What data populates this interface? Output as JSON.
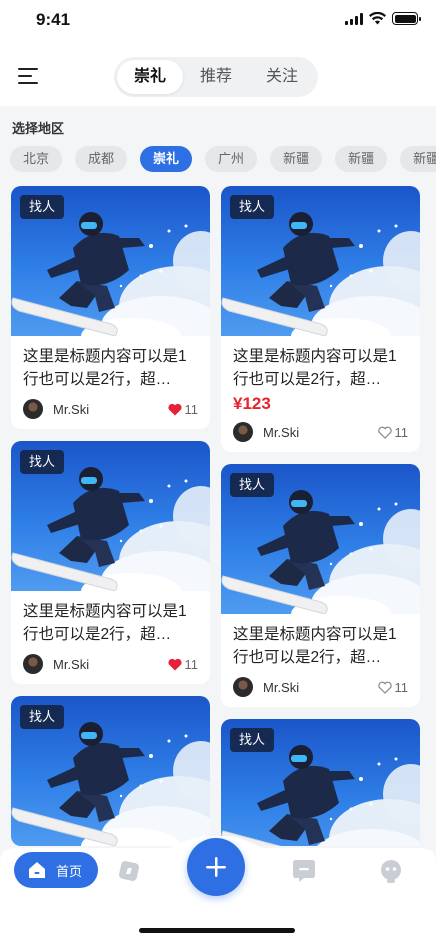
{
  "status_bar": {
    "time": "9:41"
  },
  "header": {
    "tabs": [
      {
        "label": "崇礼",
        "active": true
      },
      {
        "label": "推荐",
        "active": false
      },
      {
        "label": "关注",
        "active": false
      }
    ]
  },
  "region": {
    "title": "选择地区",
    "chips": [
      {
        "label": "北京",
        "active": false
      },
      {
        "label": "成都",
        "active": false
      },
      {
        "label": "崇礼",
        "active": true
      },
      {
        "label": "广州",
        "active": false
      },
      {
        "label": "新疆",
        "active": false
      },
      {
        "label": "新疆",
        "active": false
      },
      {
        "label": "新疆",
        "active": false
      }
    ]
  },
  "cards": [
    {
      "tag": "找人",
      "title": "这里是标题内容可以是1行也可以是2行，超…",
      "price": "",
      "user": "Mr.Ski",
      "likes": "11",
      "liked": true
    },
    {
      "tag": "找人",
      "title": "这里是标题内容可以是1行也可以是2行，超…",
      "price": "¥123",
      "user": "Mr.Ski",
      "likes": "11",
      "liked": false
    },
    {
      "tag": "找人",
      "title": "这里是标题内容可以是1行也可以是2行，超…",
      "price": "",
      "user": "Mr.Ski",
      "likes": "11",
      "liked": true
    },
    {
      "tag": "找人",
      "title": "这里是标题内容可以是1行也可以是2行，超…",
      "price": "",
      "user": "Mr.Ski",
      "likes": "11",
      "liked": false
    },
    {
      "tag": "找人",
      "title": "",
      "price": "",
      "user": "",
      "likes": "",
      "liked": false
    },
    {
      "tag": "找人",
      "title": "",
      "price": "",
      "user": "",
      "likes": "",
      "liked": false
    }
  ],
  "bottom_nav": {
    "home_label": "首页",
    "items": [
      "home-icon",
      "compass-icon",
      "add-icon",
      "message-icon",
      "profile-icon"
    ]
  },
  "colors": {
    "accent": "#2f6fe4",
    "price": "#e6242b",
    "heart": "#e8213a"
  }
}
